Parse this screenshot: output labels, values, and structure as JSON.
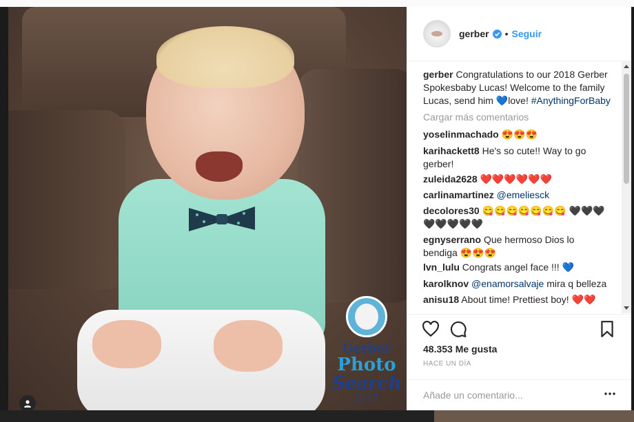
{
  "post": {
    "username": "gerber",
    "follow_label": "Seguir",
    "separator": "•",
    "caption": {
      "username": "gerber",
      "text": "Congratulations to our 2018 Gerber Spokesbaby Lucas! Welcome to the family Lucas, send him",
      "emoji": "💙",
      "after_emoji": "love!",
      "hashtag": "#AnythingForBaby"
    },
    "load_more": "Cargar más comentarios",
    "comments": [
      {
        "user": "yoselinmachado",
        "text": "😍😍😍"
      },
      {
        "user": "karihackett8",
        "text": "He's so cute!! Way to go gerber!"
      },
      {
        "user": "zuleida2628",
        "text": "❤️❤️❤️❤️❤️❤️"
      },
      {
        "user": "carlinamartinez",
        "mention": "@emeliesck",
        "text": ""
      },
      {
        "user": "decolores30",
        "text": "😋😋😋😋😋😋😋 🖤🖤🖤🖤🖤🖤🖤🖤"
      },
      {
        "user": "egnyserrano",
        "text": "Que hermoso Dios lo bendiga 😍😍😍"
      },
      {
        "user": "lvn_lulu",
        "text": "Congrats angel face !!! 💙"
      },
      {
        "user": "karolknov",
        "mention": "@enamorsalvaje",
        "text": "mira q belleza"
      },
      {
        "user": "anisu18",
        "text": "About time! Prettiest boy! ❤️❤️"
      }
    ],
    "likes": "48.353 Me gusta",
    "time": "HACE UN DÍA",
    "add_comment_placeholder": "Añade un comentario...",
    "logo": {
      "brand": "Gerber",
      "line1": "Photo",
      "line2": "Search",
      "year": "2017"
    }
  },
  "colors": {
    "link_blue": "#3897f0",
    "hashtag": "#003569",
    "text": "#262626",
    "muted": "#999999"
  },
  "icons": [
    "verified-badge-icon",
    "heart-icon",
    "comment-icon",
    "bookmark-icon",
    "more-options-icon",
    "user-tag-icon"
  ]
}
